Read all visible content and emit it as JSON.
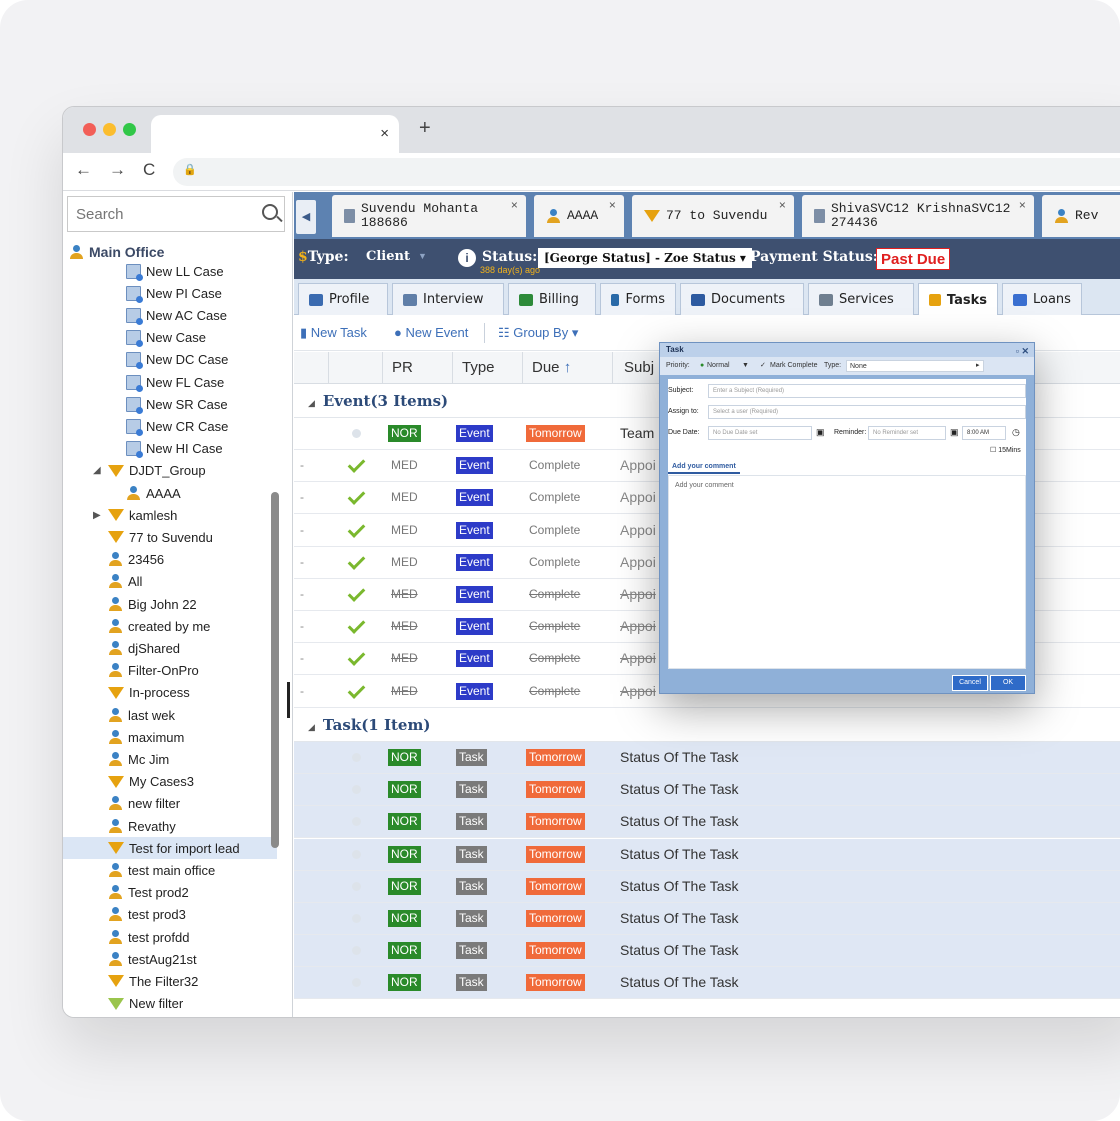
{
  "browser": {
    "close_glyph": "×",
    "new_tab_glyph": "+",
    "back_glyph": "←",
    "forward_glyph": "→",
    "reload_glyph": "C",
    "lock_glyph": "🔒"
  },
  "sidebar": {
    "search_placeholder": "Search",
    "root_label": "Main Office",
    "items": [
      {
        "label": "New LL Case",
        "icon": "doc-icon",
        "indent": 2
      },
      {
        "label": "New PI Case",
        "icon": "doc-icon",
        "indent": 2
      },
      {
        "label": "New AC Case",
        "icon": "doc-icon",
        "indent": 2
      },
      {
        "label": "New Case",
        "icon": "doc-icon",
        "indent": 2
      },
      {
        "label": "New DC Case",
        "icon": "doc-icon",
        "indent": 2
      },
      {
        "label": "New FL Case",
        "icon": "doc-icon",
        "indent": 2
      },
      {
        "label": "New SR Case",
        "icon": "doc-icon",
        "indent": 2
      },
      {
        "label": "New CR Case",
        "icon": "doc-icon",
        "indent": 2
      },
      {
        "label": "New HI Case",
        "icon": "doc-icon",
        "indent": 2
      },
      {
        "label": "DJDT_Group",
        "icon": "filter-icon",
        "indent": 1,
        "toggle": "◢"
      },
      {
        "label": "AAAA",
        "icon": "user-icon",
        "indent": 2
      },
      {
        "label": "kamlesh",
        "icon": "filter-icon",
        "indent": 1,
        "toggle": "▶"
      },
      {
        "label": "77 to Suvendu",
        "icon": "filter-icon",
        "indent": 1
      },
      {
        "label": "23456",
        "icon": "user-icon",
        "indent": 1
      },
      {
        "label": "All",
        "icon": "user-icon",
        "indent": 1
      },
      {
        "label": "Big John 22",
        "icon": "user-icon",
        "indent": 1
      },
      {
        "label": "created by me",
        "icon": "user-icon",
        "indent": 1
      },
      {
        "label": "djShared",
        "icon": "user-icon",
        "indent": 1
      },
      {
        "label": "Filter-OnPro",
        "icon": "user-icon",
        "indent": 1
      },
      {
        "label": "In-process",
        "icon": "filter-icon",
        "indent": 1
      },
      {
        "label": "last wek",
        "icon": "user-icon",
        "indent": 1
      },
      {
        "label": "maximum",
        "icon": "user-icon",
        "indent": 1
      },
      {
        "label": "Mc Jim",
        "icon": "user-icon",
        "indent": 1
      },
      {
        "label": "My Cases3",
        "icon": "filter-icon",
        "indent": 1
      },
      {
        "label": "new filter",
        "icon": "user-icon",
        "indent": 1
      },
      {
        "label": "Revathy",
        "icon": "user-icon",
        "indent": 1
      },
      {
        "label": "Test for import lead",
        "icon": "filter-icon",
        "indent": 1,
        "selected": true
      },
      {
        "label": "test main office",
        "icon": "user-icon",
        "indent": 1
      },
      {
        "label": "Test prod2",
        "icon": "user-icon",
        "indent": 1
      },
      {
        "label": "test prod3",
        "icon": "user-icon",
        "indent": 1
      },
      {
        "label": "test profdd",
        "icon": "user-icon",
        "indent": 1
      },
      {
        "label": "testAug21st",
        "icon": "user-icon",
        "indent": 1
      },
      {
        "label": "The Filter32",
        "icon": "filter-icon",
        "indent": 1
      },
      {
        "label": "New filter",
        "icon": "filter2-icon",
        "indent": 1
      }
    ]
  },
  "record_tabs": [
    {
      "line1": "Suvendu Mohanta",
      "line2": "188686",
      "icon": "page-icon"
    },
    {
      "line1": "AAAA",
      "line2": "",
      "icon": "user-icon"
    },
    {
      "line1": "77 to Suvendu",
      "line2": "",
      "icon": "filter-icon"
    },
    {
      "line1": "ShivaSVC12 KrishnaSVC12",
      "line2": "274436",
      "icon": "page-icon"
    },
    {
      "line1": "Rev",
      "line2": "",
      "icon": "user-icon"
    }
  ],
  "statusbar": {
    "type_label": "Type:",
    "type_value": "Client",
    "status_label": "Status:",
    "status_value": "[George Status] - Zoe Status",
    "status_age": "388 day(s) ago",
    "payment_label": "Payment Status:",
    "payment_value": "Past Due"
  },
  "main_tabs": [
    {
      "label": "Profile",
      "color": "#3b6bb0"
    },
    {
      "label": "Interview",
      "color": "#5f7ea8"
    },
    {
      "label": "Billing",
      "color": "#2d8a3a"
    },
    {
      "label": "Forms",
      "color": "#2a6aa8"
    },
    {
      "label": "Documents",
      "color": "#2d5aa0"
    },
    {
      "label": "Services",
      "color": "#6f7f90"
    },
    {
      "label": "Tasks",
      "color": "#e6a20f",
      "active": true
    },
    {
      "label": "Loans",
      "color": "#3a6fd0"
    }
  ],
  "toolbar": {
    "new_task": "New Task",
    "new_event": "New Event",
    "group_by": "Group By"
  },
  "grid": {
    "columns": {
      "pr": "PR",
      "type": "Type",
      "due": "Due",
      "subject": "Subj"
    },
    "event_group": "Event(3 Items)",
    "task_group": "Task(1 Item)",
    "event_rows": [
      {
        "pr": "NOR",
        "type": "Event",
        "due": "Tomorrow",
        "subject": "Team",
        "state": "open"
      },
      {
        "pr": "MED",
        "type": "Event",
        "due": "Complete",
        "subject": "Appoi",
        "state": "done"
      },
      {
        "pr": "MED",
        "type": "Event",
        "due": "Complete",
        "subject": "Appoi",
        "state": "done"
      },
      {
        "pr": "MED",
        "type": "Event",
        "due": "Complete",
        "subject": "Appoi",
        "state": "done"
      },
      {
        "pr": "MED",
        "type": "Event",
        "due": "Complete",
        "subject": "Appoi",
        "state": "done"
      },
      {
        "pr": "MED",
        "type": "Event",
        "due": "Complete",
        "subject": "Appoi",
        "state": "done-strike"
      },
      {
        "pr": "MED",
        "type": "Event",
        "due": "Complete",
        "subject": "Appoi",
        "state": "done-strike"
      },
      {
        "pr": "MED",
        "type": "Event",
        "due": "Complete",
        "subject": "Appoi",
        "state": "done-strike"
      },
      {
        "pr": "MED",
        "type": "Event",
        "due": "Complete",
        "subject": "Appoi",
        "state": "done-strike"
      }
    ],
    "task_rows": [
      {
        "pr": "NOR",
        "type": "Task",
        "due": "Tomorrow",
        "subject": "Status Of The Task"
      },
      {
        "pr": "NOR",
        "type": "Task",
        "due": "Tomorrow",
        "subject": "Status Of The Task"
      },
      {
        "pr": "NOR",
        "type": "Task",
        "due": "Tomorrow",
        "subject": "Status Of The Task"
      },
      {
        "pr": "NOR",
        "type": "Task",
        "due": "Tomorrow",
        "subject": "Status Of The Task"
      },
      {
        "pr": "NOR",
        "type": "Task",
        "due": "Tomorrow",
        "subject": "Status Of The Task"
      },
      {
        "pr": "NOR",
        "type": "Task",
        "due": "Tomorrow",
        "subject": "Status Of The Task"
      },
      {
        "pr": "NOR",
        "type": "Task",
        "due": "Tomorrow",
        "subject": "Status Of The Task"
      },
      {
        "pr": "NOR",
        "type": "Task",
        "due": "Tomorrow",
        "subject": "Status Of The Task"
      }
    ]
  },
  "dialog": {
    "title": "Task",
    "priority_label": "Priority:",
    "priority_value": "Normal",
    "mark_complete": "Mark Complete",
    "type_label": "Type:",
    "type_value": "None",
    "subject_label": "Subject:",
    "subject_placeholder": "Enter a Subject (Required)",
    "assign_label": "Assign to:",
    "assign_placeholder": "Select a user (Required)",
    "due_label": "Due Date:",
    "due_placeholder": "No Due Date set",
    "reminder_label": "Reminder:",
    "reminder_placeholder": "No Reminder set",
    "time_value": "8:00 AM",
    "mins_label": "15Mins",
    "comment_tab": "Add your comment",
    "comment_placeholder": "Add your comment",
    "cancel": "Cancel",
    "ok": "OK"
  }
}
